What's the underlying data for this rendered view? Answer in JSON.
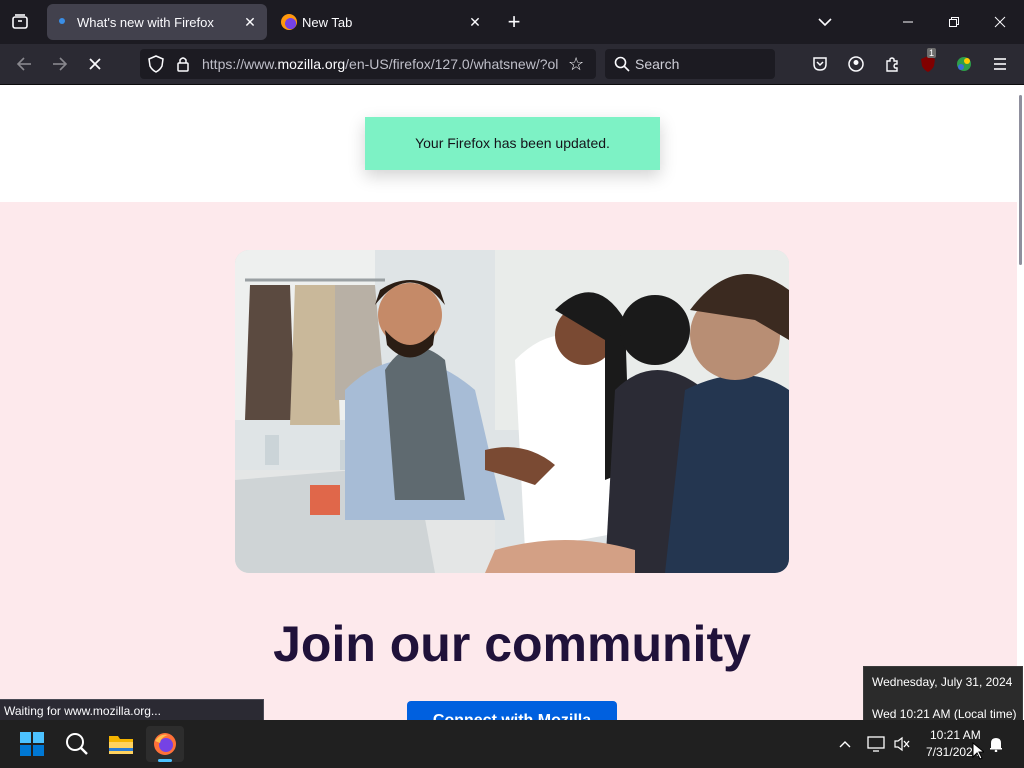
{
  "tabs": [
    {
      "title": "What's new with Firefox",
      "active": true
    },
    {
      "title": "New Tab",
      "active": false
    }
  ],
  "url": {
    "prefix": "https://www.",
    "domain": "mozilla.org",
    "rest": "/en-US/firefox/127.0/whatsnew/?ol"
  },
  "search": {
    "placeholder": "Search"
  },
  "extension_badge": "1",
  "page": {
    "notice": "Your Firefox has been updated.",
    "heading": "Join our community",
    "cta": "Connect with Mozilla"
  },
  "status_text": "Waiting for www.mozilla.org...",
  "clock_tooltip": {
    "line1": "Wednesday, July 31, 2024",
    "line2": "Wed 10:21 AM (Local time)"
  },
  "clock": {
    "time": "10:21 AM",
    "date": "7/31/2024"
  },
  "colors": {
    "accent": "#0060df",
    "notice_bg": "#7df2c5",
    "band_bg": "#fde9ec",
    "heading": "#20123a"
  }
}
